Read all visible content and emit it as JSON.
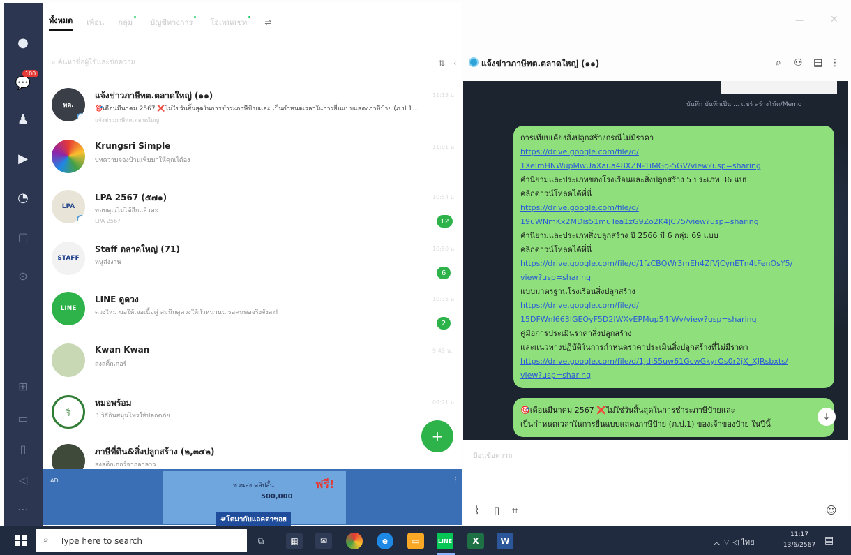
{
  "window": {
    "minimize": "—",
    "close": "✕"
  },
  "tabs": [
    {
      "label": "ทั้งหมด",
      "active": true
    },
    {
      "label": "เพื่อน"
    },
    {
      "label": "กลุ่ม",
      "dot": true
    },
    {
      "label": "บัญชีทางการ",
      "dot": true
    },
    {
      "label": "โอเพนแชท",
      "dot": true
    }
  ],
  "rail": {
    "chat_badge": "100"
  },
  "search": {
    "placeholder": "ค้นหาชื่อผู้ใช้และข้อความ"
  },
  "chats": [
    {
      "name": "แจ้งข่าวภาษีทต.ตลาดใหญ่ (๑๑)",
      "preview": "🎯เดือนมีนาคม 2567 ❌ไม่ใช่วันสิ้นสุดในการชำระภาษีป้ายและ เป็นกำหนดเวลาในการยื่นแบบแสดงภาษีป้าย (ภ.ป.1...",
      "sub": "แจ้งข่าวภาษีทต.ตลาดใหญ่",
      "time": "11:13 น.",
      "unread": ""
    },
    {
      "name": "Krungsri Simple",
      "preview": "บทความจองบ้านเพิ่มมาให้คุณได้อง",
      "sub": "",
      "time": "11:01 น.",
      "unread": ""
    },
    {
      "name": "LPA 2567 (๕๗๑)",
      "preview": "ขอบคุณไม่ได้อีกแล้วคะ",
      "sub": "LPA 2567",
      "time": "10:54 น.",
      "unread": "12"
    },
    {
      "name": "Staff ตลาดใหญ่ (71)",
      "preview": "หนูส่งงาน",
      "sub": "",
      "time": "10:50 น.",
      "unread": "6"
    },
    {
      "name": "LINE ดูดวง",
      "preview": "ดวงใหม่ ขอให้เจอเนื้อคู่ สมนึกดูดวงให้กำหนานน รอคนพอจริงจังละ!",
      "sub": "",
      "time": "10:35 น.",
      "unread": "2"
    },
    {
      "name": "Kwan Kwan",
      "preview": "ส่งสติ๊กเกอร์",
      "sub": "",
      "time": "9:49 น.",
      "unread": ""
    },
    {
      "name": "หมอพร้อม",
      "preview": "3 วิธีกินสมุนไพรให้ปลอดภัย",
      "sub": "",
      "time": "09:21 น.",
      "unread": ""
    },
    {
      "name": "ภาษีที่ดิน&สิ่งปลูกสร้าง (๒,๓๔๒)",
      "preview": "ส่งสติกเกอร์จากอาลาว",
      "sub": "",
      "time": "",
      "unread": ""
    }
  ],
  "fab": {
    "icon": "+"
  },
  "ad": {
    "label": "AD",
    "headline": "ชวนส่ง คลิปสั้น",
    "amount": "500,000",
    "free": "ฟรี!",
    "cta": "#โตมากับแลคตาซอย",
    "menu": "⋮"
  },
  "conversation": {
    "title": "แจ้งข่าวภาษีทต.ตลาดใหญ่ (๑๑)",
    "quick_actions": "บันทึก  บันทึกเป็น  ...  แชร์  สร้างโน้ต/Memo",
    "bubble1": {
      "lines": [
        {
          "type": "text",
          "value": "การเทียบเคียงสิ่งปลูกสร้างกรณีไม่มีราคา"
        },
        {
          "type": "link",
          "value": "https://drive.google.com/file/d/"
        },
        {
          "type": "link",
          "value": "1XelmHNWupMwUaXaua48XZN-1iMGg-5GV/view?usp=sharing"
        },
        {
          "type": "text",
          "value": "คำนิยามและประเภทของโรงเรือนและสิ่งปลูกสร้าง 5 ประเภท 36 แบบ"
        },
        {
          "type": "text",
          "value": "คลิกดาวน์โหลดได้ที่นี่"
        },
        {
          "type": "link",
          "value": "https://drive.google.com/file/d/"
        },
        {
          "type": "link",
          "value": "19uWNmKx2MDis51muTea1zG9Zo2K4JC75/view?usp=sharing"
        },
        {
          "type": "text",
          "value": "คำนิยามและประเภทสิ่งปลูกสร้าง ปี 2566 มี 6 กลุ่ม 69 แบบ"
        },
        {
          "type": "text",
          "value": "คลิกดาวน์โหลดได้ที่นี่"
        },
        {
          "type": "link",
          "value": "https://drive.google.com/file/d/1fzCBQWr3mEh4ZfVjCynETn4tFenOsY5/"
        },
        {
          "type": "link",
          "value": "view?usp=sharing"
        },
        {
          "type": "text",
          "value": "แบบมาตรฐานโรงเรือนสิ่งปลูกสร้าง"
        },
        {
          "type": "link",
          "value": "https://drive.google.com/file/d/"
        },
        {
          "type": "link",
          "value": "15DFWnl663IGEOyF5D2IWXvEPMup54fWv/view?usp=sharing"
        },
        {
          "type": "text",
          "value": "คู่มือการประเมินราคาสิ่งปลูกสร้าง"
        },
        {
          "type": "text",
          "value": "และแนวทางปฏิบัติในการกำหนดราคาประเมินสิ่งปลูกสร้างที่ไม่มีราคา"
        },
        {
          "type": "link",
          "value": "https://drive.google.com/file/d/1JdiS5uw61GcwGkyrOs0r2jX_XJRsbxts/"
        },
        {
          "type": "link",
          "value": "view?usp=sharing"
        }
      ]
    },
    "bubble2": {
      "lines": [
        {
          "type": "text",
          "value": "🎯เดือนมีนาคม 2567 ❌ไม่ใช่วันสิ้นสุดในการชำระภาษีป้ายและ"
        },
        {
          "type": "text",
          "value": "เป็นกำหนดเวลาในการยื่นแบบแสดงภาษีป้าย (ภ.ป.1) ของเจ้าของป้าย ในปีนี้"
        }
      ]
    },
    "input_placeholder": "ป้อนข้อความ"
  },
  "taskbar": {
    "search_text": "Type here to search",
    "time": "11:17",
    "date": "13/6/2567",
    "lang": "ไทย"
  }
}
